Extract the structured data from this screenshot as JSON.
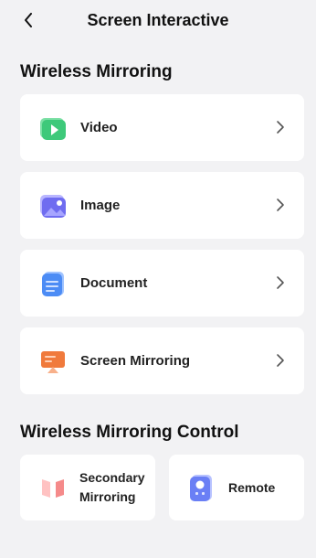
{
  "header": {
    "title": "Screen Interactive"
  },
  "sections": {
    "wireless_mirroring": "Wireless Mirroring",
    "wireless_mirroring_control": "Wireless Mirroring Control"
  },
  "items": [
    {
      "label": "Video",
      "icon": "video-icon"
    },
    {
      "label": "Image",
      "icon": "image-icon"
    },
    {
      "label": "Document",
      "icon": "document-icon"
    },
    {
      "label": "Screen Mirroring",
      "icon": "screen-mirroring-icon"
    }
  ],
  "controls": [
    {
      "label_line1": "Secondary",
      "label_line2": "Mirroring",
      "icon": "secondary-mirroring-icon"
    },
    {
      "label": "Remote",
      "icon": "remote-icon"
    }
  ],
  "colors": {
    "background": "#f2f2f4",
    "card": "#ffffff",
    "video": "#3ec97a",
    "image": "#6f6cf0",
    "document": "#4c8cf5",
    "screen_mirroring": "#f07a3c",
    "secondary_mirroring": "#f58a8a",
    "remote": "#6a7ff5"
  }
}
